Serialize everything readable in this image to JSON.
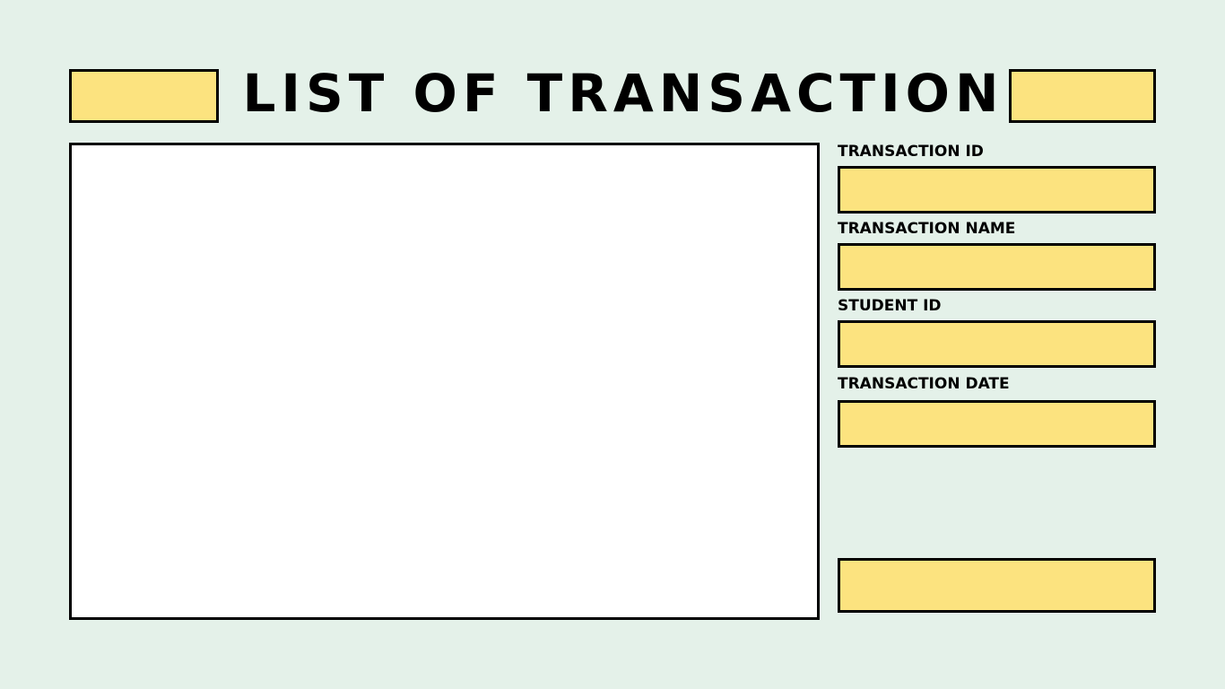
{
  "colors": {
    "background": "#e4f1e9",
    "accent_yellow": "#fce37f",
    "panel": "#ffffff",
    "border": "#000000",
    "text": "#000000"
  },
  "header": {
    "title": "LIST OF TRANSACTION",
    "left_button_label": "",
    "right_button_label": ""
  },
  "list_panel": {
    "rows": []
  },
  "form": {
    "fields": [
      {
        "label": "TRANSACTION ID",
        "value": "",
        "placeholder": ""
      },
      {
        "label": "TRANSACTION NAME",
        "value": "",
        "placeholder": ""
      },
      {
        "label": "STUDENT ID",
        "value": "",
        "placeholder": ""
      },
      {
        "label": "TRANSACTION DATE",
        "value": "",
        "placeholder": ""
      }
    ],
    "action_button_label": ""
  }
}
